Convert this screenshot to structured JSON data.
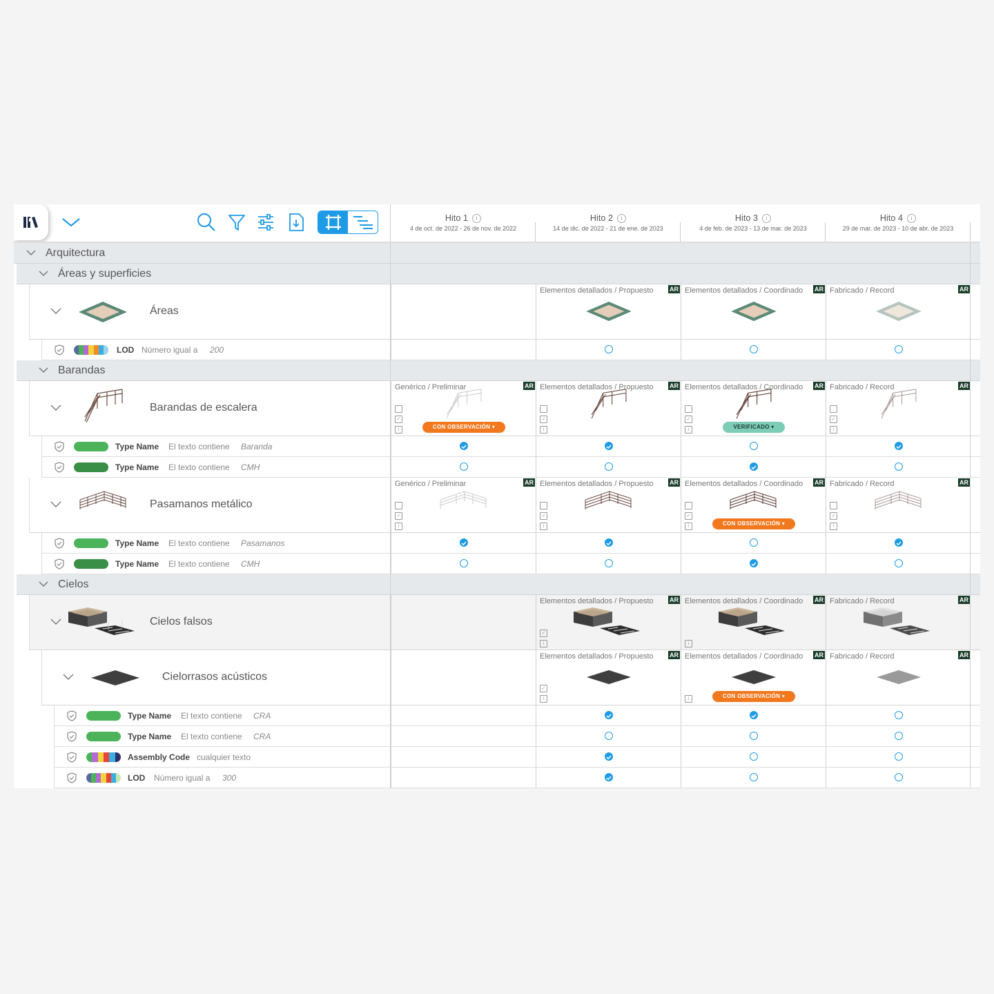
{
  "toolbar": {
    "library_icon": "library-books-icon",
    "dropdown_icon": "chevron-down-icon",
    "search_icon": "search-icon",
    "filter_icon": "filter-icon",
    "settings_icon": "sliders-icon",
    "export_icon": "file-download-icon",
    "view_grid_icon": "crop-frame-icon",
    "view_list_icon": "indent-list-icon",
    "accent": "#1e9be6"
  },
  "milestones": [
    {
      "title": "Hito 1",
      "dates": "4 de oct. de 2022 - 26 de nov. de 2022"
    },
    {
      "title": "Hito 2",
      "dates": "14 de dic. de 2022 - 21 de ene. de 2023"
    },
    {
      "title": "Hito 3",
      "dates": "4 de feb. de 2023 - 13 de mar. de 2023"
    },
    {
      "title": "Hito 4",
      "dates": "29 de mar. de 2023 - 10 de abr. de 2023"
    }
  ],
  "info_glyph": "i",
  "ar_tag": "AR",
  "doc_icons": {
    "file": "file-icon",
    "check": "checklist-icon",
    "info": "info-doc-icon"
  },
  "groups": {
    "arquitectura": "Arquitectura",
    "areas": "Áreas y superficies",
    "barandas": "Barandas",
    "cielos": "Cielos"
  },
  "elements": {
    "areas": {
      "name": "Áreas",
      "cells": [
        "",
        "Elementos detallados / Propuesto",
        "Elementos detallados / Coordinado",
        "Fabricado / Record"
      ]
    },
    "barandas_escalera": {
      "name": "Barandas de escalera",
      "cells": [
        "Genérico / Preliminar",
        "Elementos detallados / Propuesto",
        "Elementos detallados / Coordinado",
        "Fabricado / Record"
      ],
      "badges": [
        "CON OBSERVACIÓN ▾",
        "VERIFICADO ▾"
      ]
    },
    "pasamanos": {
      "name": "Pasamanos metálico",
      "cells": [
        "Genérico / Preliminar",
        "Elementos detallados / Propuesto",
        "Elementos detallados / Coordinado",
        "Fabricado / Record"
      ],
      "badges": [
        "CON OBSERVACIÓN ▾"
      ]
    },
    "cielos_falsos": {
      "name": "Cielos falsos",
      "cells": [
        "",
        "Elementos detallados / Propuesto",
        "Elementos detallados / Coordinado",
        "Fabricado / Record"
      ]
    },
    "cielorrasos": {
      "name": "Cielorrasos acústicos",
      "cells": [
        "",
        "Elementos detallados / Propuesto",
        "Elementos detallados / Coordinado",
        "Fabricado / Record"
      ],
      "badges": [
        "CON OBSERVACIÓN ▾"
      ]
    }
  },
  "rules": {
    "r1": {
      "param": "LOD",
      "cond": "Número igual a",
      "value": "200",
      "checks": [
        null,
        false,
        false,
        false
      ]
    },
    "r2": {
      "param": "Type Name",
      "cond": "El texto contiene",
      "value": "Baranda",
      "checks": [
        true,
        true,
        false,
        true
      ]
    },
    "r3": {
      "param": "Type Name",
      "cond": "El texto contiene",
      "value": "CMH",
      "checks": [
        false,
        false,
        true,
        false
      ]
    },
    "r4": {
      "param": "Type Name",
      "cond": "El texto contiene",
      "value": "Pasamanos",
      "checks": [
        true,
        true,
        false,
        true
      ]
    },
    "r5": {
      "param": "Type Name",
      "cond": "El texto contiene",
      "value": "CMH",
      "checks": [
        false,
        false,
        true,
        false
      ]
    },
    "r6": {
      "param": "Type Name",
      "cond": "El texto contiene",
      "value": "CRA",
      "checks": [
        null,
        true,
        true,
        false
      ]
    },
    "r7": {
      "param": "Type Name",
      "cond": "El texto contiene",
      "value": "CRA",
      "checks": [
        null,
        false,
        false,
        false
      ]
    },
    "r8": {
      "param": "Assembly Code",
      "cond": "cualquier texto",
      "value": "",
      "checks": [
        null,
        true,
        false,
        false
      ]
    },
    "r9": {
      "param": "LOD",
      "cond": "Número igual a",
      "value": "300",
      "checks": [
        null,
        true,
        false,
        false
      ]
    }
  },
  "colors": {
    "green_pill": "#4cb35a",
    "dark_green_pill": "#3a8f47",
    "orange": "#f2781e",
    "teal": "#7dccb5",
    "ar_bg": "#1a3d2a",
    "group_bg": "#e6e9ec"
  }
}
